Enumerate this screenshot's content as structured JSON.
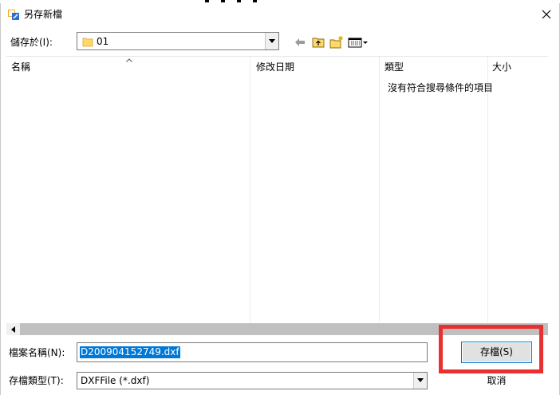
{
  "dialog": {
    "title": "另存新檔"
  },
  "lookin": {
    "label": "儲存於(I):",
    "value": "01"
  },
  "listview": {
    "columns": [
      "名稱",
      "修改日期",
      "類型",
      "大小"
    ],
    "empty_message": "沒有符合搜尋條件的項目"
  },
  "filename": {
    "label": "檔案名稱(N):",
    "value": "D200904152749.dxf"
  },
  "filetype": {
    "label": "存檔類型(T):",
    "value": "DXFFile (*.dxf)"
  },
  "buttons": {
    "save": "存檔(S)",
    "cancel": "取消"
  },
  "colors": {
    "selection": "#0078d7",
    "highlight": "#e8312f",
    "folder": "#ffd86a"
  }
}
